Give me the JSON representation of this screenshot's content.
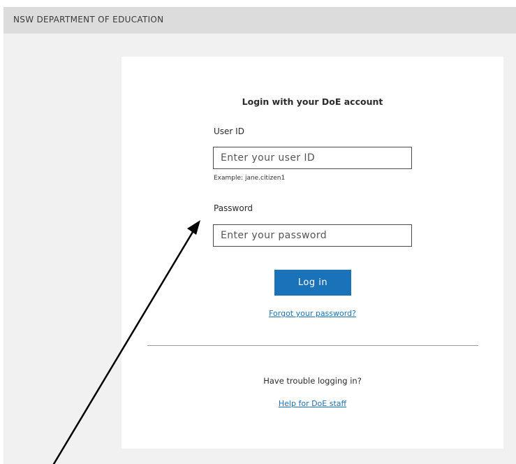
{
  "header": {
    "title": "NSW DEPARTMENT OF EDUCATION"
  },
  "login_form": {
    "heading": "Login with your DoE account",
    "user_id": {
      "label": "User ID",
      "placeholder": "Enter your user ID",
      "value": "",
      "hint": "Example: jane.citizen1"
    },
    "password": {
      "label": "Password",
      "placeholder": "Enter your password",
      "value": ""
    },
    "login_button_label": "Log in",
    "forgot_password_link": "Forgot your password?"
  },
  "help_section": {
    "trouble_text": "Have trouble logging in?",
    "help_link": "Help for DoE staff"
  },
  "colors": {
    "page_background": "#f1f1f1",
    "header_background": "#dcdcdc",
    "accent_blue": "#1a72b8",
    "annotation_arrow": "#000000"
  },
  "icons": {
    "annotation": "arrow-pointing-up-right"
  }
}
